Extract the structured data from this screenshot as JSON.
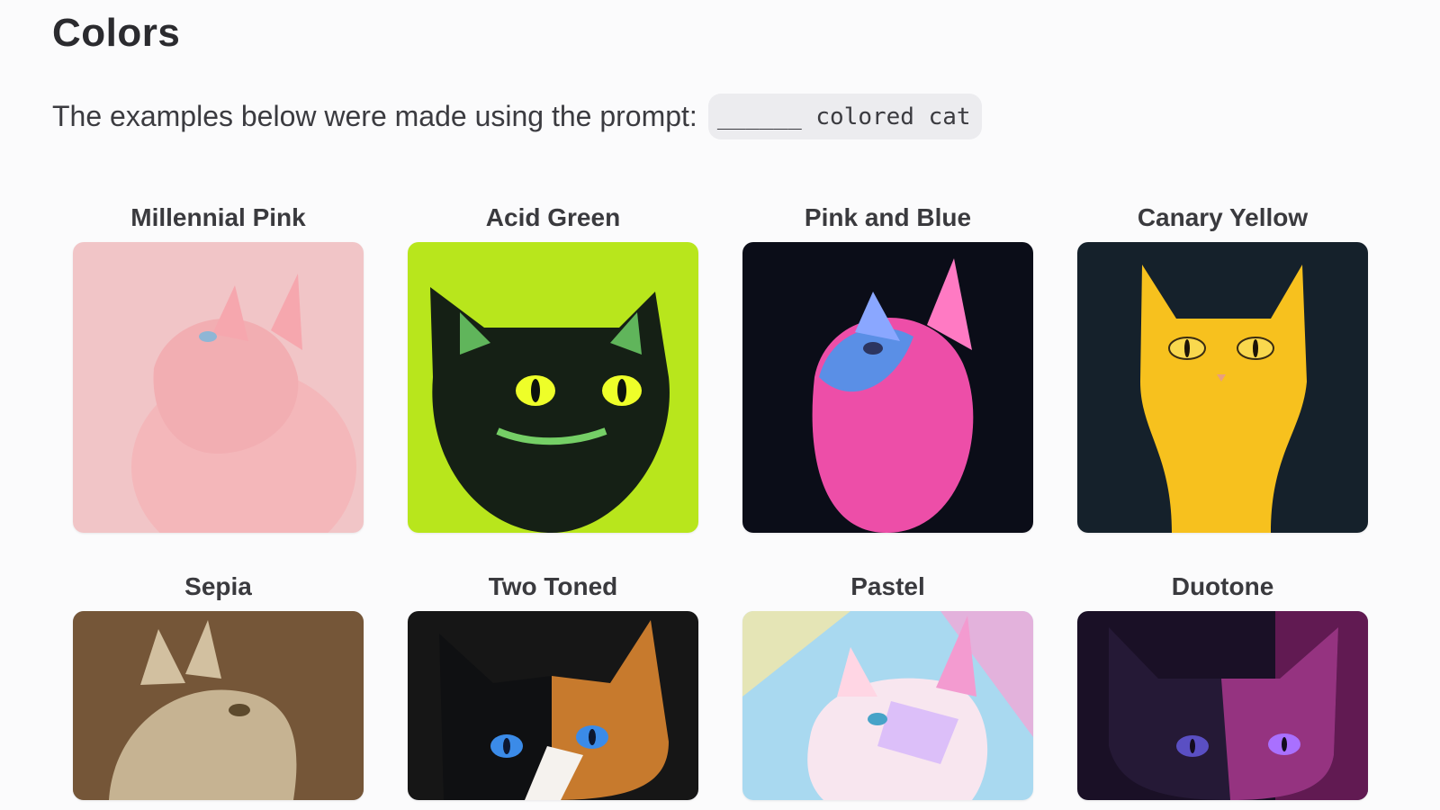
{
  "page": {
    "title": "Colors",
    "intro": "The examples below were made using the prompt:",
    "prompt_code": "______ colored cat"
  },
  "cards": [
    {
      "label": "Millennial Pink",
      "icon": "cat-image-icon"
    },
    {
      "label": "Acid Green",
      "icon": "cat-image-icon"
    },
    {
      "label": "Pink and Blue",
      "icon": "cat-image-icon"
    },
    {
      "label": "Canary Yellow",
      "icon": "cat-image-icon"
    },
    {
      "label": "Sepia",
      "icon": "cat-image-icon"
    },
    {
      "label": "Two Toned",
      "icon": "cat-image-icon"
    },
    {
      "label": "Pastel",
      "icon": "cat-image-icon"
    },
    {
      "label": "Duotone",
      "icon": "cat-image-icon"
    }
  ],
  "colors": {
    "background": "#fbfbfc",
    "text": "#2f2f33",
    "code_bg": "#ececef"
  }
}
